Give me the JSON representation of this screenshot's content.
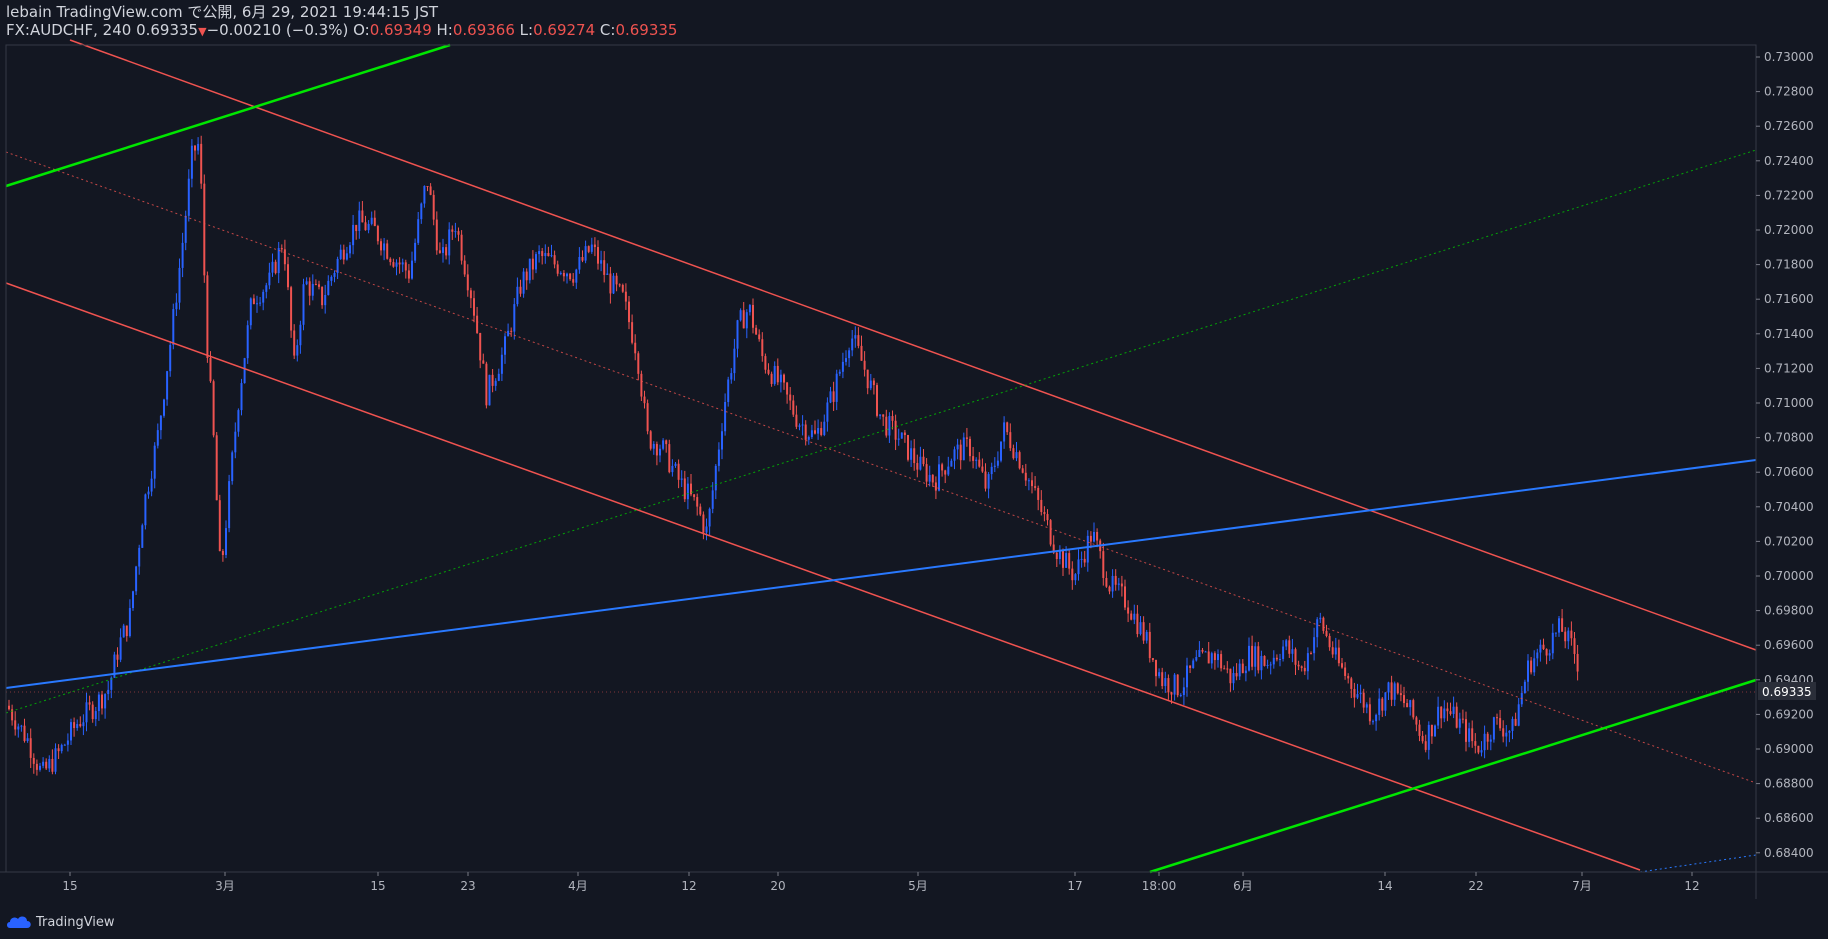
{
  "header": {
    "line1": "lebain TradingView.com で公開, 6月 29, 2021 19:44:15 JST",
    "symbol": "FX:AUDCHF, 240 0.69335",
    "change": "−0.00210 (−0.3%)",
    "o_label": "O:",
    "o_value": "0.69349",
    "h_label": "H:",
    "h_value": "0.69366",
    "l_label": "L:",
    "l_value": "0.69274",
    "c_label": "C:",
    "c_value": "0.69335"
  },
  "footer": {
    "brand": "TradingView"
  },
  "colors": {
    "background": "#131722",
    "up": "#2962ff",
    "down": "#ef5350",
    "channel": "#ef5350",
    "green": "#00e600",
    "blue_line": "#2979ff",
    "axis_text": "#b2b5be",
    "last_price_label_bg": "#2a2e39"
  },
  "chart_data": {
    "type": "candlestick",
    "symbol": "FX:AUDCHF",
    "interval": "240",
    "last_price": "0.69335",
    "y_ticks": [
      "0.73000",
      "0.72800",
      "0.72600",
      "0.72400",
      "0.72200",
      "0.72000",
      "0.71800",
      "0.71600",
      "0.71400",
      "0.71200",
      "0.71000",
      "0.70800",
      "0.70600",
      "0.70400",
      "0.70200",
      "0.70000",
      "0.69800",
      "0.69600",
      "0.69400",
      "0.69200",
      "0.69000",
      "0.68800",
      "0.68600",
      "0.68400"
    ],
    "y_tick_values": [
      0.73,
      0.728,
      0.726,
      0.724,
      0.722,
      0.72,
      0.718,
      0.716,
      0.714,
      0.712,
      0.71,
      0.708,
      0.706,
      0.704,
      0.702,
      0.7,
      0.698,
      0.696,
      0.694,
      0.692,
      0.69,
      0.688,
      0.686,
      0.684
    ],
    "x_ticks": [
      "15",
      "3月",
      "15",
      "23",
      "4月",
      "12",
      "20",
      "5月",
      "17",
      "18:00",
      "6月",
      "14",
      "22",
      "7月",
      "12"
    ],
    "price_path": [
      [
        0,
        0.6925
      ],
      [
        0.012,
        0.6905
      ],
      [
        0.02,
        0.6885
      ],
      [
        0.03,
        0.6898
      ],
      [
        0.04,
        0.6915
      ],
      [
        0.05,
        0.6925
      ],
      [
        0.058,
        0.6935
      ],
      [
        0.064,
        0.696
      ],
      [
        0.07,
        0.6975
      ],
      [
        0.078,
        0.704
      ],
      [
        0.086,
        0.708
      ],
      [
        0.094,
        0.714
      ],
      [
        0.1,
        0.719
      ],
      [
        0.106,
        0.7245
      ],
      [
        0.11,
        0.725
      ],
      [
        0.114,
        0.714
      ],
      [
        0.118,
        0.708
      ],
      [
        0.122,
        0.7
      ],
      [
        0.126,
        0.704
      ],
      [
        0.132,
        0.71
      ],
      [
        0.14,
        0.716
      ],
      [
        0.15,
        0.717
      ],
      [
        0.158,
        0.7195
      ],
      [
        0.164,
        0.712
      ],
      [
        0.17,
        0.717
      ],
      [
        0.18,
        0.716
      ],
      [
        0.19,
        0.7185
      ],
      [
        0.2,
        0.7205
      ],
      [
        0.21,
        0.72
      ],
      [
        0.22,
        0.7185
      ],
      [
        0.23,
        0.7175
      ],
      [
        0.24,
        0.723
      ],
      [
        0.248,
        0.718
      ],
      [
        0.256,
        0.7205
      ],
      [
        0.266,
        0.716
      ],
      [
        0.274,
        0.7105
      ],
      [
        0.284,
        0.713
      ],
      [
        0.294,
        0.717
      ],
      [
        0.304,
        0.7185
      ],
      [
        0.314,
        0.718
      ],
      [
        0.324,
        0.7175
      ],
      [
        0.334,
        0.719
      ],
      [
        0.344,
        0.717
      ],
      [
        0.352,
        0.716
      ],
      [
        0.36,
        0.713
      ],
      [
        0.366,
        0.708
      ],
      [
        0.374,
        0.7075
      ],
      [
        0.384,
        0.7055
      ],
      [
        0.394,
        0.704
      ],
      [
        0.4,
        0.7025
      ],
      [
        0.41,
        0.71
      ],
      [
        0.418,
        0.7145
      ],
      [
        0.424,
        0.7155
      ],
      [
        0.432,
        0.7125
      ],
      [
        0.442,
        0.711
      ],
      [
        0.452,
        0.709
      ],
      [
        0.462,
        0.708
      ],
      [
        0.472,
        0.7105
      ],
      [
        0.482,
        0.714
      ],
      [
        0.49,
        0.712
      ],
      [
        0.5,
        0.709
      ],
      [
        0.51,
        0.708
      ],
      [
        0.52,
        0.7065
      ],
      [
        0.53,
        0.7055
      ],
      [
        0.54,
        0.707
      ],
      [
        0.55,
        0.7075
      ],
      [
        0.56,
        0.705
      ],
      [
        0.57,
        0.7085
      ],
      [
        0.58,
        0.7065
      ],
      [
        0.59,
        0.704
      ],
      [
        0.6,
        0.7015
      ],
      [
        0.61,
        0.7
      ],
      [
        0.62,
        0.7025
      ],
      [
        0.63,
        0.6995
      ],
      [
        0.64,
        0.6985
      ],
      [
        0.65,
        0.6965
      ],
      [
        0.66,
        0.694
      ],
      [
        0.67,
        0.6935
      ],
      [
        0.68,
        0.695
      ],
      [
        0.69,
        0.6955
      ],
      [
        0.7,
        0.694
      ],
      [
        0.71,
        0.6955
      ],
      [
        0.72,
        0.695
      ],
      [
        0.73,
        0.696
      ],
      [
        0.74,
        0.6945
      ],
      [
        0.75,
        0.6975
      ],
      [
        0.76,
        0.695
      ],
      [
        0.77,
        0.6935
      ],
      [
        0.78,
        0.692
      ],
      [
        0.79,
        0.6935
      ],
      [
        0.8,
        0.6925
      ],
      [
        0.81,
        0.6905
      ],
      [
        0.82,
        0.6925
      ],
      [
        0.83,
        0.6915
      ],
      [
        0.84,
        0.69
      ],
      [
        0.85,
        0.6915
      ],
      [
        0.86,
        0.691
      ],
      [
        0.87,
        0.695
      ],
      [
        0.88,
        0.696
      ],
      [
        0.888,
        0.697
      ],
      [
        0.896,
        0.6955
      ],
      [
        0.902,
        0.6935
      ]
    ]
  }
}
